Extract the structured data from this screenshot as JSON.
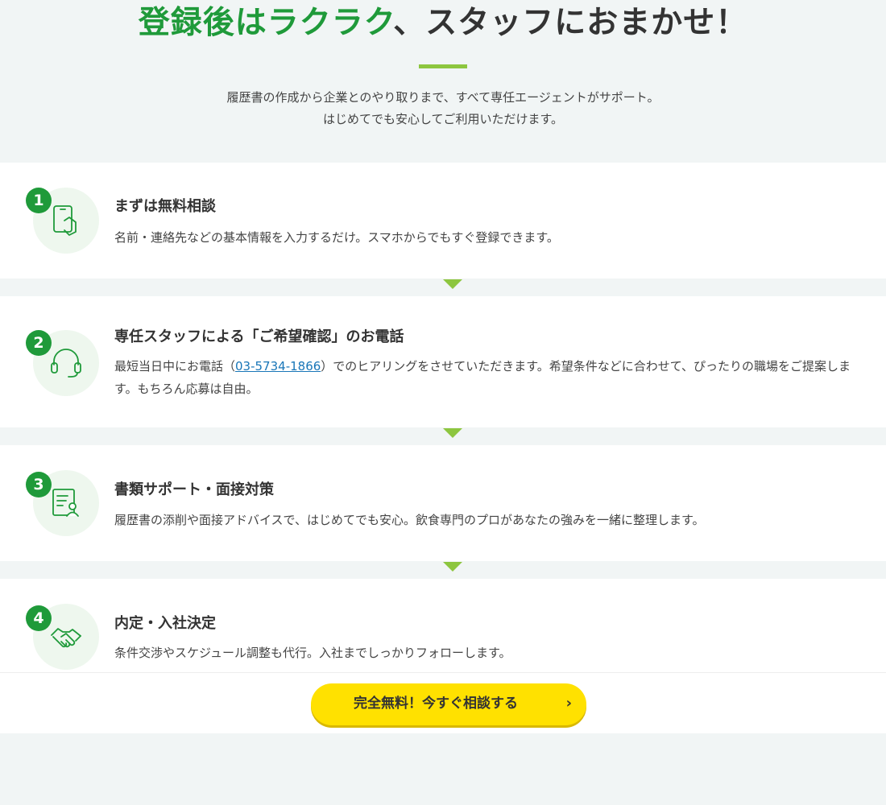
{
  "header": {
    "title_green": "登録後はラクラク",
    "title_dark": "、スタッフにおまかせ！",
    "lead_line1": "履歴書の作成から企業とのやり取りまで、すべて専任エージェントがサポート。",
    "lead_line2": "はじめてでも安心してご利用いただけます。"
  },
  "steps": [
    {
      "number": "1",
      "icon": "smartphone-icon",
      "title": "まずは無料相談",
      "desc": "名前・連絡先などの基本情報を入力するだけ。スマホからでもすぐ登録できます。"
    },
    {
      "number": "2",
      "icon": "headset-icon",
      "title": "専任スタッフによる「ご希望確認」のお電話",
      "desc_before": "最短当日中にお電話（",
      "phone": "03-5734-1866",
      "desc_after": "）でのヒアリングをさせていただきます。希望条件などに合わせて、ぴったりの職場をご提案します。もちろん応募は自由。"
    },
    {
      "number": "3",
      "icon": "resume-icon",
      "title": "書類サポート・面接対策",
      "desc": "履歴書の添削や面接アドバイスで、はじめてでも安心。飲食専門のプロがあなたの強みを一緒に整理します。"
    },
    {
      "number": "4",
      "icon": "handshake-icon",
      "title": "内定・入社決定",
      "desc": "条件交渉やスケジュール調整も代行。入社までしっかりフォローします。"
    }
  ],
  "cta": {
    "label": "完全無料！今すぐ相談する",
    "chevron": "›"
  },
  "colors": {
    "green": "#1f9a3a",
    "accent": "#8dc63f",
    "cta_yellow": "#ffe100",
    "link": "#1976b8"
  }
}
